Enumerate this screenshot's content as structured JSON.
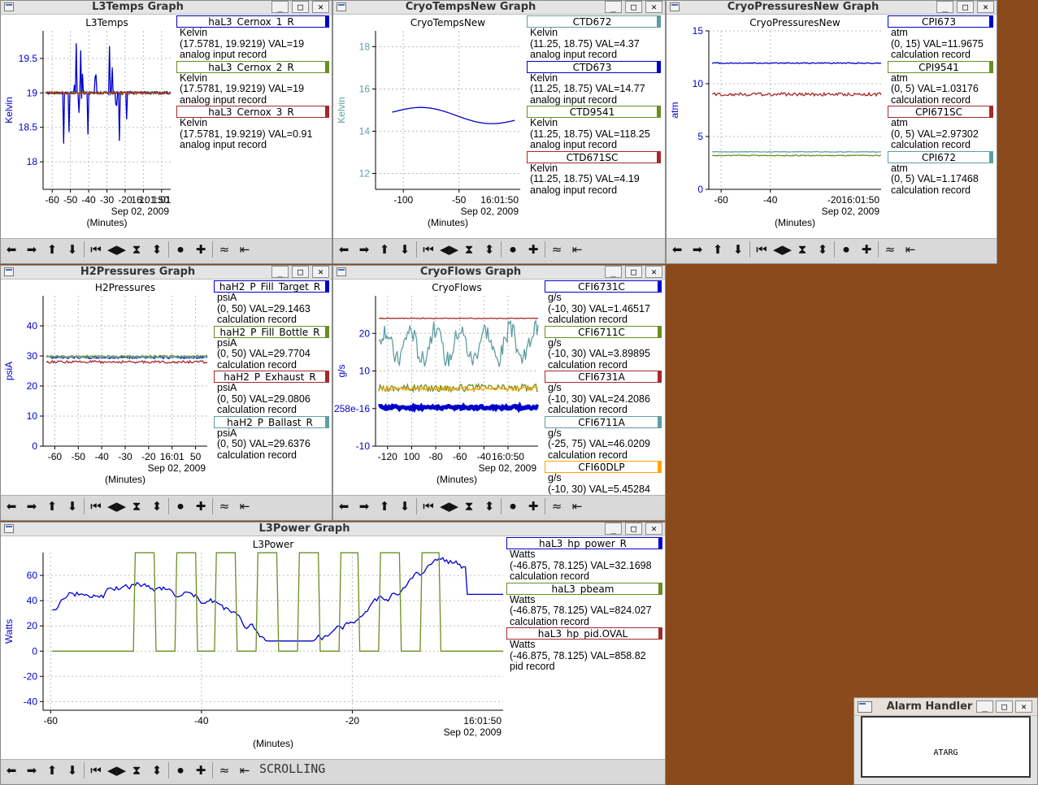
{
  "windows": [
    {
      "id": "l3temps",
      "title": "L3Temps Graph",
      "plot_title": "L3Temps",
      "ylabel": "Kelvin",
      "xlabel": "(Minutes)",
      "date": "Sep 02, 2009",
      "ylim": [
        17.6,
        19.9
      ],
      "yticks": [
        18,
        18.5,
        19,
        19.5
      ],
      "ytick_labels": [
        "18",
        "18.5",
        "19",
        "19.5"
      ],
      "xlim": [
        -65,
        5
      ],
      "xticks": [
        -60,
        -50,
        -40,
        -30,
        -20,
        -10,
        0
      ],
      "xtick_labels": [
        "-60",
        "-50",
        "-40",
        "-30",
        "-20",
        "1:",
        "1:01"
      ],
      "time_label": "16:01:50",
      "legend": [
        {
          "name": "haL3_Cernox_1_R",
          "color": "#0000cc",
          "lines": [
            "Kelvin",
            "(17.5781, 19.9219) VAL=19",
            "analog input record"
          ]
        },
        {
          "name": "haL3_Cernox_2_R",
          "color": "#6b8e23",
          "lines": [
            "Kelvin",
            "(17.5781, 19.9219) VAL=19",
            "analog input record"
          ]
        },
        {
          "name": "haL3_Cernox_3_R",
          "color": "#a52a2a",
          "lines": [
            "Kelvin",
            "(17.5781, 19.9219) VAL=0.91",
            "analog input record"
          ]
        }
      ]
    },
    {
      "id": "cryotempsnew",
      "title": "CryoTempsNew Graph",
      "plot_title": "CryoTempsNew",
      "ylabel": "Kelvin",
      "xlabel": "(Minutes)",
      "date": "Sep 02, 2009",
      "ylim": [
        11.25,
        18.75
      ],
      "yticks": [
        12,
        14,
        16,
        18
      ],
      "ytick_labels": [
        "12",
        "14",
        "16",
        "18"
      ],
      "xlim": [
        -125,
        5
      ],
      "xticks": [
        -100,
        -50
      ],
      "xtick_labels": [
        "-100",
        "-50"
      ],
      "time_label": "16:01:50",
      "legend": [
        {
          "name": "CTD672",
          "color": "#5f9ea0",
          "lines": [
            "Kelvin",
            "(11.25, 18.75) VAL=4.37",
            "analog input record"
          ]
        },
        {
          "name": "CTD673",
          "color": "#0000cc",
          "lines": [
            "Kelvin",
            "(11.25, 18.75) VAL=14.77",
            "analog input record"
          ]
        },
        {
          "name": "CTD9541",
          "color": "#6b8e23",
          "lines": [
            "Kelvin",
            "(11.25, 18.75) VAL=118.25",
            "analog input record"
          ]
        },
        {
          "name": "CTD671SC",
          "color": "#a52a2a",
          "lines": [
            "Kelvin",
            "(11.25, 18.75) VAL=4.19",
            "analog input record"
          ]
        }
      ]
    },
    {
      "id": "cryopressuresnew",
      "title": "CryoPressuresNew Graph",
      "plot_title": "CryoPressuresNew",
      "ylabel": "atm",
      "xlabel": "(Minutes)",
      "date": "Sep 02, 2009",
      "ylim": [
        0,
        15
      ],
      "yticks": [
        0,
        5,
        10,
        15
      ],
      "ytick_labels": [
        "0",
        "5",
        "10",
        "15"
      ],
      "xlim": [
        -65,
        5
      ],
      "xticks": [
        -60,
        -40
      ],
      "xtick_labels": [
        "-60",
        "-40"
      ],
      "time_label": "-2016:01:50",
      "legend": [
        {
          "name": "CPI673",
          "color": "#0000cc",
          "lines": [
            "atm",
            "(0, 15) VAL=11.9675",
            "calculation record"
          ]
        },
        {
          "name": "CPI9541",
          "color": "#6b8e23",
          "lines": [
            "atm",
            "(0, 5) VAL=1.03176",
            "calculation record"
          ]
        },
        {
          "name": "CPI671SC",
          "color": "#a52a2a",
          "lines": [
            "atm",
            "(0, 5) VAL=2.97302",
            "calculation record"
          ]
        },
        {
          "name": "CPI672",
          "color": "#5f9ea0",
          "lines": [
            "atm",
            "(0, 5) VAL=1.17468",
            "calculation record"
          ]
        }
      ]
    },
    {
      "id": "h2pressures",
      "title": "H2Pressures Graph",
      "plot_title": "H2Pressures",
      "ylabel": "psiA",
      "xlabel": "(Minutes)",
      "date": "Sep 02, 2009",
      "ylim": [
        0,
        50
      ],
      "yticks": [
        0,
        10,
        20,
        30,
        40
      ],
      "ytick_labels": [
        "0",
        "10",
        "20",
        "30",
        "40"
      ],
      "xlim": [
        -65,
        5
      ],
      "xticks": [
        -60,
        -50,
        -40,
        -30,
        -20,
        -10,
        0
      ],
      "xtick_labels": [
        "-60",
        "-50",
        "-40",
        "-30",
        "-20",
        "16:01",
        "50"
      ],
      "time_label": "",
      "legend": [
        {
          "name": "haH2_P_Fill_Target_R",
          "color": "#0000cc",
          "lines": [
            "psiA",
            "(0, 50) VAL=29.1463",
            "calculation record"
          ]
        },
        {
          "name": "haH2_P_Fill_Bottle_R",
          "color": "#6b8e23",
          "lines": [
            "psiA",
            "(0, 50) VAL=29.7704",
            "calculation record"
          ]
        },
        {
          "name": "haH2_P_Exhaust_R",
          "color": "#a52a2a",
          "lines": [
            "psiA",
            "(0, 50) VAL=29.0806",
            "calculation record"
          ]
        },
        {
          "name": "haH2_P_Ballast_R",
          "color": "#5f9ea0",
          "lines": [
            "psiA",
            "(0, 50) VAL=29.6376",
            "calculation record"
          ]
        }
      ]
    },
    {
      "id": "cryoflows",
      "title": "CryoFlows Graph",
      "plot_title": "CryoFlows",
      "ylabel": "g/s",
      "xlabel": "(Minutes)",
      "date": "Sep 02, 2009",
      "ylim": [
        -10,
        30
      ],
      "yticks": [
        -10,
        0,
        10,
        20
      ],
      "ytick_labels": [
        "-10",
        "258e-16",
        "10",
        "20"
      ],
      "xlim": [
        -130,
        5
      ],
      "xticks": [
        -120,
        -100,
        -80,
        -60,
        -40,
        -20
      ],
      "xtick_labels": [
        "-120",
        "100",
        "-80",
        "-60",
        "-40",
        "16:0:50"
      ],
      "time_label": "",
      "legend": [
        {
          "name": "CFI6731C",
          "color": "#0000cc",
          "lines": [
            "g/s",
            "(-10, 30) VAL=1.46517",
            "calculation record"
          ]
        },
        {
          "name": "CFI6711C",
          "color": "#6b8e23",
          "lines": [
            "g/s",
            "(-10, 30) VAL=3.89895",
            "calculation record"
          ]
        },
        {
          "name": "CFI6731A",
          "color": "#a52a2a",
          "lines": [
            "g/s",
            "(-10, 30) VAL=24.2086",
            "calculation record"
          ]
        },
        {
          "name": "CFI6711A",
          "color": "#5f9ea0",
          "lines": [
            "g/s",
            "(-25, 75) VAL=46.0209",
            "calculation record"
          ]
        },
        {
          "name": "CFI60DLP",
          "color": "#ffa500",
          "lines": [
            "g/s",
            "(-10, 30) VAL=5.45284",
            "calculation record"
          ]
        }
      ]
    },
    {
      "id": "l3power",
      "title": "L3Power Graph",
      "plot_title": "L3Power",
      "ylabel": "Watts",
      "xlabel": "(Minutes)",
      "date": "Sep 02, 2009",
      "ylim": [
        -46.875,
        78.125
      ],
      "yticks": [
        -40,
        -20,
        0,
        20,
        40,
        60
      ],
      "ytick_labels": [
        "-40",
        "-20",
        "0",
        "20",
        "40",
        "60"
      ],
      "xlim": [
        -61,
        0
      ],
      "xticks": [
        -60,
        -40,
        -20
      ],
      "xtick_labels": [
        "-60",
        "-40",
        "-20"
      ],
      "time_label": "16:01:50",
      "status": "SCROLLING",
      "legend": [
        {
          "name": "haL3_hp_power_R",
          "color": "#0000cc",
          "lines": [
            "Watts",
            "(-46.875, 78.125) VAL=32.1698",
            "calculation record"
          ]
        },
        {
          "name": "haL3_pbeam",
          "color": "#6b8e23",
          "lines": [
            "Watts",
            "(-46.875, 78.125) VAL=824.027",
            "calculation record"
          ]
        },
        {
          "name": "haL3_hp_pid.OVAL",
          "color": "#a52a2a",
          "lines": [
            "Watts",
            "(-46.875, 78.125) VAL=858.82",
            "pid record"
          ]
        }
      ]
    }
  ],
  "alarm": {
    "title": "Alarm Handler",
    "item": "ATARG"
  },
  "toolbar_icons": [
    "arrow-left-icon",
    "arrow-right-icon",
    "arrow-up-icon",
    "arrow-down-icon",
    "step-start-icon",
    "step-both-icon",
    "hourglass-icon",
    "up-down-icon",
    "circle-icon",
    "plus-icon",
    "zigzag-icon",
    "end-icon"
  ],
  "toolbar_glyphs": [
    "⬅",
    "➡",
    "⬆",
    "⬇",
    "⏮",
    "◀▶",
    "⧗",
    "⬍",
    "⏺",
    "✚",
    "≈",
    "⇤"
  ],
  "window_buttons": {
    "minimize": "_",
    "maximize": "□",
    "close": "✕"
  }
}
